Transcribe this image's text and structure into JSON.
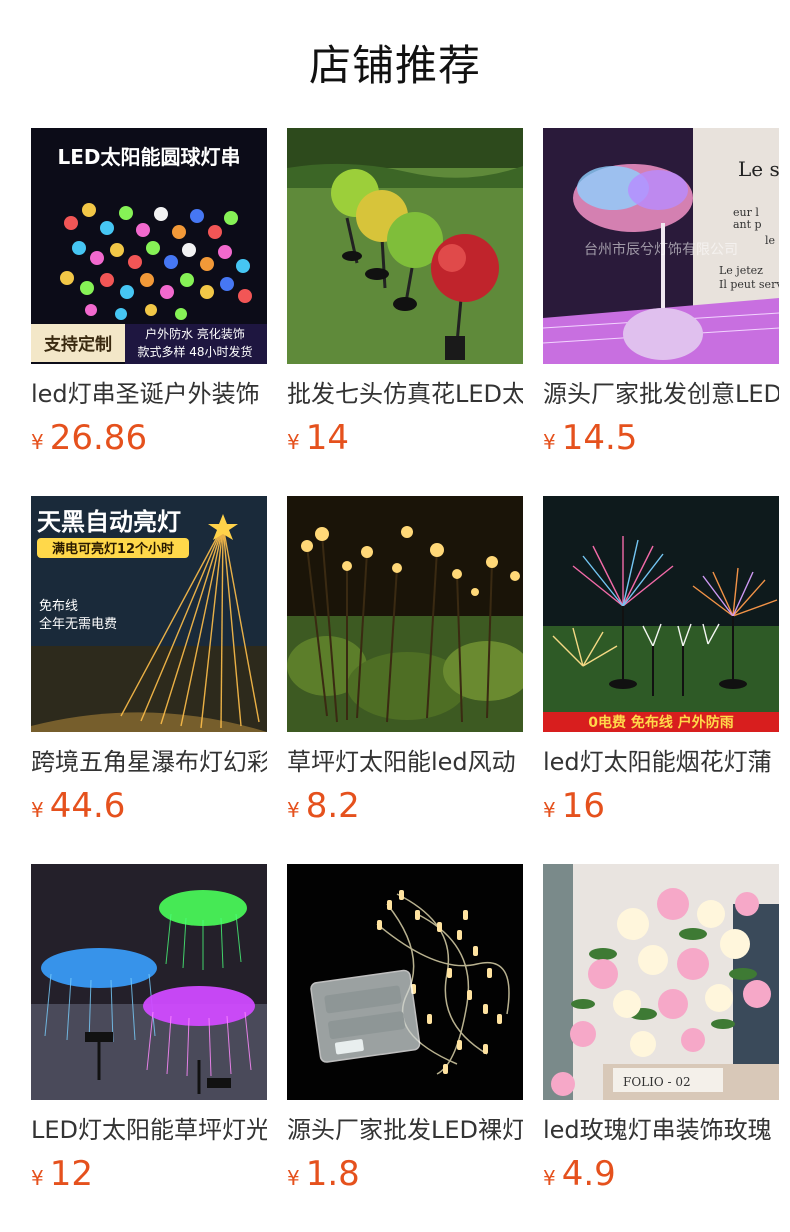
{
  "section": {
    "title": "店铺推荐"
  },
  "colors": {
    "price": "#e5511d",
    "title": "#111111",
    "name": "#333333"
  },
  "products": [
    {
      "name": "led灯串圣诞户外装饰",
      "currency": "¥",
      "price": "26.86",
      "image_text": [
        "LED太阳能圆球灯串",
        "户外防水 亮化装饰",
        "款式多样 48小时发货",
        "支持定制"
      ]
    },
    {
      "name": "批发七头仿真花LED太",
      "currency": "¥",
      "price": "14",
      "image_text": []
    },
    {
      "name": "源头厂家批发创意LED",
      "currency": "¥",
      "price": "14.5",
      "image_text": [
        "台州市辰兮灯饰有限公司",
        "Le sa",
        "eur l",
        "ant p",
        "le",
        "Le jetez",
        "Il peut servi"
      ]
    },
    {
      "name": "跨境五角星瀑布灯幻彩",
      "currency": "¥",
      "price": "44.6",
      "image_text": [
        "天黑自动亮灯",
        "满电可亮灯12个小时",
        "免布线",
        "全年无需电费"
      ]
    },
    {
      "name": "草坪灯太阳能led风动",
      "currency": "¥",
      "price": "8.2",
      "image_text": []
    },
    {
      "name": "led灯太阳能烟花灯蒲",
      "currency": "¥",
      "price": "16",
      "image_text": [
        "0电费 免布线 户外防雨"
      ]
    },
    {
      "name": "LED灯太阳能草坪灯光",
      "currency": "¥",
      "price": "12",
      "image_text": []
    },
    {
      "name": "源头厂家批发LED裸灯",
      "currency": "¥",
      "price": "1.8",
      "image_text": []
    },
    {
      "name": "led玫瑰灯串装饰玫瑰",
      "currency": "¥",
      "price": "4.9",
      "image_text": [
        "FOLIO - 02"
      ]
    }
  ]
}
